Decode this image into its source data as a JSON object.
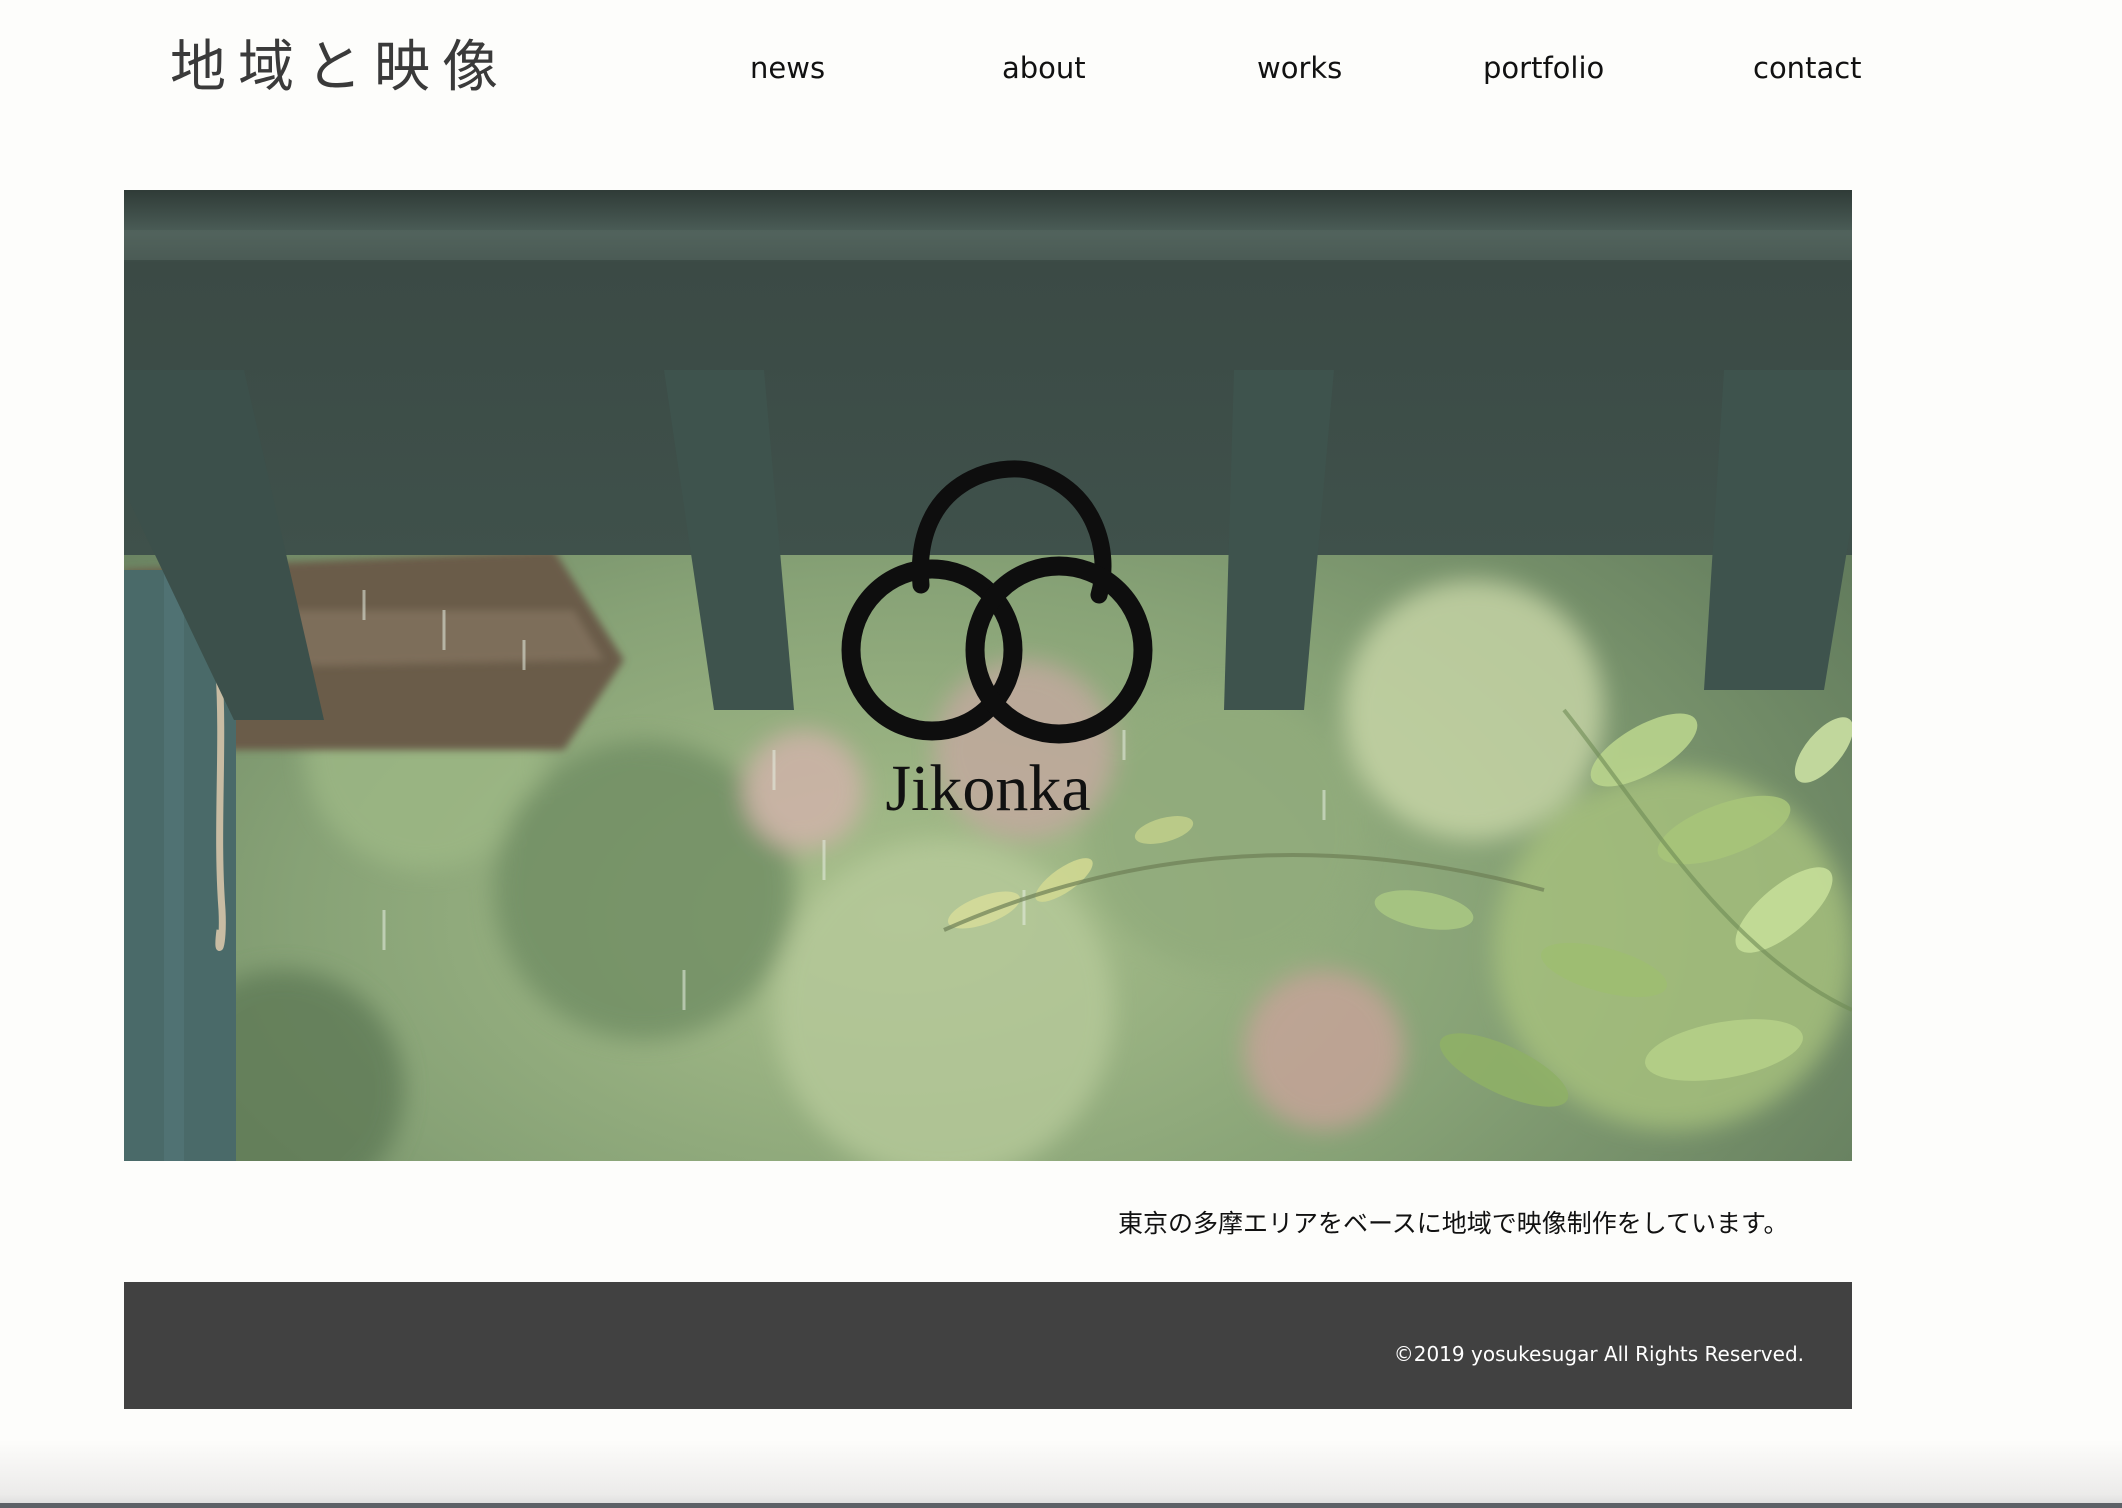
{
  "site": {
    "logo_text": "地域と映像"
  },
  "nav": {
    "items": [
      {
        "label": "news"
      },
      {
        "label": "about"
      },
      {
        "label": "works"
      },
      {
        "label": "portfolio"
      },
      {
        "label": "contact"
      }
    ]
  },
  "hero": {
    "brand_text": "Jikonka",
    "logo_icon": "triple-ring-logo"
  },
  "tagline": "東京の多摩エリアをベースに地域で映像制作をしています。",
  "footer": {
    "copyright": "©2019 yosukesugar All Rights Reserved."
  },
  "colors": {
    "background": "#fdfdfb",
    "footer": "#414141",
    "text": "#111111"
  }
}
